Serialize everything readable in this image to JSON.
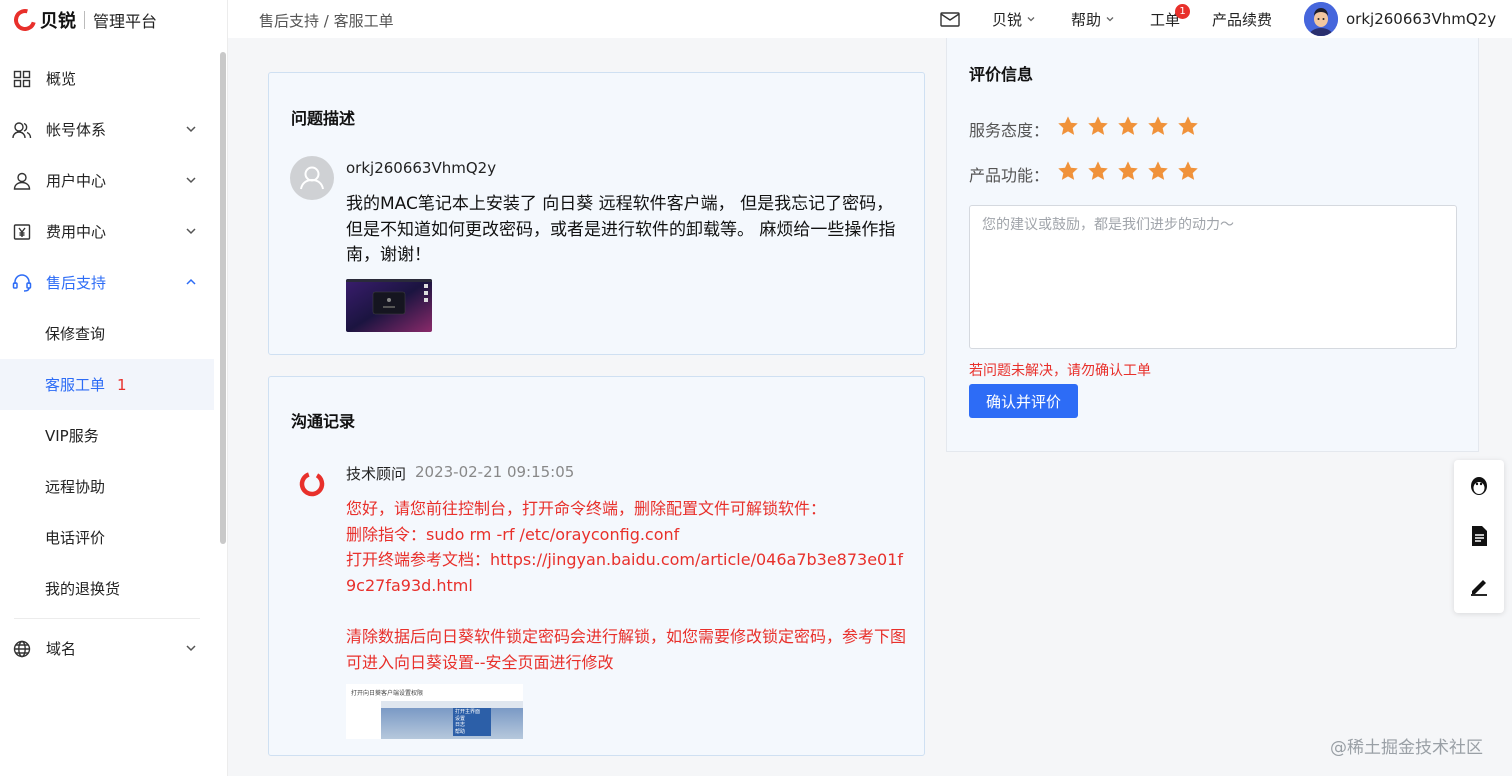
{
  "brand": {
    "name": "贝锐",
    "subtitle": "管理平台",
    "accent": "#e8302b"
  },
  "sidebar": {
    "items": [
      {
        "label": "概览",
        "icon": "grid-icon"
      },
      {
        "label": "帐号体系",
        "icon": "users-icon"
      },
      {
        "label": "用户中心",
        "icon": "user-icon"
      },
      {
        "label": "费用中心",
        "icon": "yen-icon"
      },
      {
        "label": "售后支持",
        "icon": "headset-icon"
      }
    ],
    "support_sub": [
      {
        "label": "保修查询"
      },
      {
        "label": "客服工单",
        "count": "1"
      },
      {
        "label": "VIP服务"
      },
      {
        "label": "远程协助"
      },
      {
        "label": "电话评价"
      },
      {
        "label": "我的退换货"
      }
    ],
    "domain": {
      "label": "域名",
      "icon": "globe-icon"
    }
  },
  "header": {
    "breadcrumb": "售后支持 / 客服工单",
    "nav": {
      "beirui": "贝锐",
      "help": "帮助",
      "ticket": "工单",
      "ticket_badge": "1",
      "renew": "产品续费"
    },
    "username": "orkj260663VhmQ2y"
  },
  "problem": {
    "title": "问题描述",
    "user": "orkj260663VhmQ2y",
    "text": "我的MAC笔记本上安装了 向日葵 远程软件客户端， 但是我忘记了密码，但是不知道如何更改密码，或者是进行软件的卸载等。 麻烦给一些操作指南，谢谢！"
  },
  "comm": {
    "title": "沟通记录",
    "author": "技术顾问",
    "time": "2023-02-21 09:15:05",
    "line1": "您好，请您前往控制台，打开命令终端，删除配置文件可解锁软件：",
    "line2": "删除指令：sudo rm -rf /etc/orayconfig.conf",
    "line3": "打开终端参考文档：https://jingyan.baidu.com/article/046a7b3e873e01f9c27fa93d.html",
    "line4": "清除数据后向日葵软件锁定密码会进行解锁，如您需要修改锁定密码，参考下图可进入向日葵设置--安全页面进行修改",
    "thumb_text": "打开向日葵客户端设置权限",
    "thumb_menu": [
      "打开主界面",
      "设置",
      "日志",
      "帮助"
    ]
  },
  "rating": {
    "title": "评价信息",
    "service_label": "服务态度：",
    "product_label": "产品功能：",
    "service_stars": 5,
    "product_stars": 5,
    "star_color": "#f0923a",
    "placeholder": "您的建议或鼓励，都是我们进步的动力～",
    "warning": "若问题未解决，请勿确认工单",
    "button": "确认并评价"
  },
  "watermark": "@稀土掘金技术社区"
}
